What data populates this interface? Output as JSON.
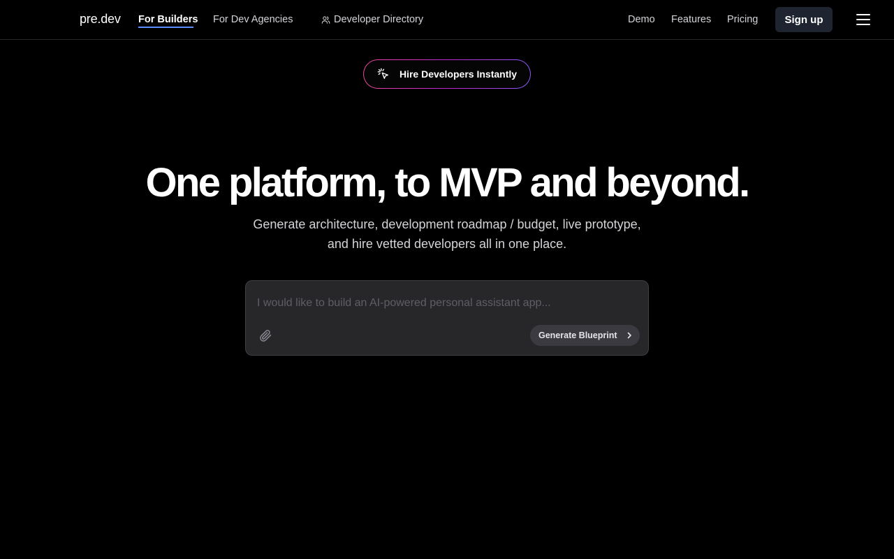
{
  "header": {
    "logo": "pre.dev",
    "nav": [
      {
        "label": "For Builders",
        "active": true
      },
      {
        "label": "For Dev Agencies"
      },
      {
        "label": "Developer Directory",
        "icon": "users-icon"
      }
    ],
    "right_nav": [
      "Demo",
      "Features",
      "Pricing"
    ],
    "signup_label": "Sign up",
    "menu_icon": "hamburger-menu-icon"
  },
  "hero": {
    "pill_label": "Hire Developers Instantly",
    "pill_icon": "cursor-click-icon",
    "headline": "One platform, to MVP and beyond.",
    "subtitle_line1": "Generate architecture, development roadmap / budget, live prototype,",
    "subtitle_line2": "and hire vetted developers all in one place."
  },
  "prompt": {
    "placeholder": "I would like to build an AI-powered personal assistant app...",
    "value": "",
    "attach_icon": "paperclip-icon",
    "button_label": "Generate Blueprint",
    "button_icon": "chevron-right-icon"
  },
  "colors": {
    "background": "#000000",
    "accent_underline": "#5b8cff",
    "pill_gradient_start": "#ec4899",
    "pill_gradient_end": "#8b5cf6",
    "signup_bg": "#1f2530",
    "prompt_bg": "#27272a"
  }
}
